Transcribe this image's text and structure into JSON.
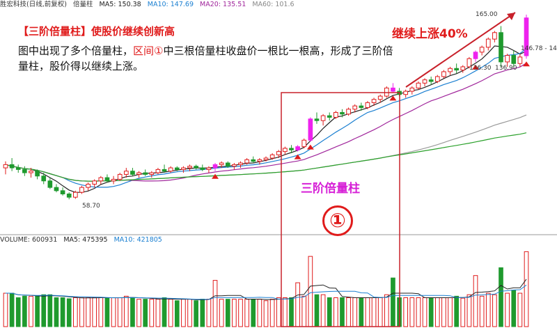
{
  "topbar": {
    "stock": "胜宏科技(日线,前复权)",
    "indicator": "倍量柱",
    "ma5": "MA5: 150.38",
    "ma10": "MA10: 147.69",
    "ma20": "MA20: 135.51",
    "ma60": "MA60: 101.6"
  },
  "annotations": {
    "headline": "【三阶倍量柱】使股价继续创新高",
    "desc_a": "图中出现了多个倍量柱，",
    "desc_zone": "区间①",
    "desc_b": "中三根倍量柱收盘价一根比一根高，形成了三阶倍量柱，股价得以继续上涨。",
    "rise": "继续上涨40%",
    "tier_label": "三阶倍量柱",
    "zone_number": "①"
  },
  "price_labels": {
    "high": "165.00",
    "low": "58.70",
    "mid_a": "136.30",
    "mid_b": "136.90",
    "right": "146.78 - 14"
  },
  "volume_bar": {
    "label": "VOLUME: 600931",
    "ma5": "MA5: 475395",
    "ma10": "MA10: 421805"
  },
  "colors": {
    "up": "#e01b1b",
    "down": "#1f9a2e",
    "double_volume": "#ee22ee",
    "ma5": "#222222",
    "ma10": "#1a7fd1",
    "ma20": "#a0259b",
    "ma60": "#9a9a9a",
    "ma120": "#2aa02a",
    "highlight_box": "#c8202a"
  },
  "chart_data": {
    "type": "candlestick",
    "price_range": [
      40,
      175
    ],
    "candles": [
      [
        78,
        82,
        74,
        80
      ],
      [
        80,
        84,
        76,
        78
      ],
      [
        78,
        80,
        75,
        77
      ],
      [
        77,
        79,
        73,
        75
      ],
      [
        75,
        78,
        72,
        76
      ],
      [
        76,
        77,
        71,
        73
      ],
      [
        73,
        75,
        68,
        70
      ],
      [
        70,
        72,
        65,
        66
      ],
      [
        66,
        68,
        63,
        64
      ],
      [
        64,
        66,
        61,
        62
      ],
      [
        62,
        63,
        58.7,
        60
      ],
      [
        60,
        64,
        59,
        63
      ],
      [
        63,
        67,
        62,
        66
      ],
      [
        66,
        69,
        64,
        68
      ],
      [
        68,
        71,
        66,
        70
      ],
      [
        70,
        73,
        68,
        72
      ],
      [
        72,
        74,
        69,
        70
      ],
      [
        70,
        73,
        68,
        71
      ],
      [
        71,
        75,
        70,
        74
      ],
      [
        74,
        78,
        72,
        76
      ],
      [
        76,
        78,
        73,
        74
      ],
      [
        74,
        76,
        72,
        75
      ],
      [
        75,
        77,
        73,
        74
      ],
      [
        74,
        76,
        72,
        75
      ],
      [
        75,
        78,
        74,
        77
      ],
      [
        77,
        80,
        75,
        76
      ],
      [
        76,
        79,
        75,
        78
      ],
      [
        78,
        79,
        76,
        77
      ],
      [
        77,
        79,
        75,
        78
      ],
      [
        78,
        80,
        76,
        79
      ],
      [
        79,
        80,
        77,
        78
      ],
      [
        78,
        80,
        76,
        77
      ],
      [
        77,
        79,
        75,
        78
      ],
      [
        78,
        81,
        76,
        80
      ],
      [
        80,
        82,
        78,
        81
      ],
      [
        81,
        82,
        78,
        79
      ],
      [
        79,
        81,
        77,
        80
      ],
      [
        80,
        82,
        78,
        81
      ],
      [
        81,
        84,
        80,
        83
      ],
      [
        83,
        85,
        81,
        82
      ],
      [
        82,
        84,
        80,
        83
      ],
      [
        83,
        85,
        82,
        84
      ],
      [
        84,
        87,
        83,
        86
      ],
      [
        86,
        89,
        84,
        88
      ],
      [
        88,
        91,
        86,
        90
      ],
      [
        90,
        92,
        87,
        89
      ],
      [
        89,
        92,
        88,
        91
      ],
      [
        91,
        96,
        90,
        95
      ],
      [
        95,
        109,
        94,
        108
      ],
      [
        108,
        112,
        105,
        107
      ],
      [
        107,
        111,
        104,
        110
      ],
      [
        110,
        112,
        107,
        109
      ],
      [
        109,
        113,
        108,
        112
      ],
      [
        112,
        114,
        109,
        111
      ],
      [
        111,
        115,
        110,
        114
      ],
      [
        114,
        117,
        112,
        116
      ],
      [
        116,
        118,
        113,
        115
      ],
      [
        115,
        119,
        114,
        118
      ],
      [
        118,
        121,
        116,
        120
      ],
      [
        120,
        123,
        118,
        122
      ],
      [
        122,
        128,
        121,
        127
      ],
      [
        127,
        130,
        124,
        125
      ],
      [
        125,
        127,
        122,
        123
      ],
      [
        123,
        126,
        121,
        125
      ],
      [
        125,
        128,
        123,
        127
      ],
      [
        127,
        131,
        126,
        130
      ],
      [
        130,
        133,
        128,
        132
      ],
      [
        132,
        134,
        129,
        131
      ],
      [
        131,
        135,
        130,
        134
      ],
      [
        134,
        138,
        133,
        137
      ],
      [
        137,
        140,
        135,
        139
      ],
      [
        139,
        142,
        136,
        138
      ],
      [
        138,
        141,
        136.3,
        140
      ],
      [
        140,
        146,
        139,
        145
      ],
      [
        145,
        150,
        143,
        149
      ],
      [
        149,
        153,
        147,
        152
      ],
      [
        152,
        158,
        150,
        157
      ],
      [
        157,
        162,
        155,
        161
      ],
      [
        161,
        165,
        140,
        143
      ],
      [
        143,
        148,
        140,
        147
      ],
      [
        147,
        150,
        140,
        142
      ],
      [
        142,
        148,
        140,
        146
      ],
      [
        146.78,
        172,
        145,
        170
      ]
    ],
    "double_volume_days": [
      33,
      46,
      48,
      61,
      74,
      82
    ]
  }
}
